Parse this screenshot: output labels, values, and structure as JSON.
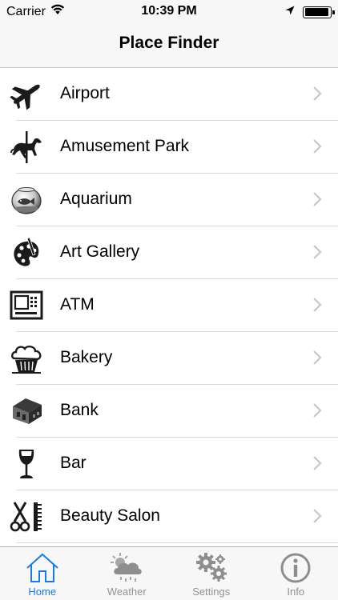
{
  "status_bar": {
    "carrier": "Carrier",
    "time": "10:39 PM",
    "battery_level": 0.95
  },
  "nav": {
    "title": "Place Finder"
  },
  "places": [
    {
      "label": "Airport",
      "icon": "airplane-icon"
    },
    {
      "label": "Amusement Park",
      "icon": "carousel-horse-icon"
    },
    {
      "label": "Aquarium",
      "icon": "fishbowl-icon"
    },
    {
      "label": "Art Gallery",
      "icon": "palette-icon"
    },
    {
      "label": "ATM",
      "icon": "atm-icon"
    },
    {
      "label": "Bakery",
      "icon": "muffin-icon"
    },
    {
      "label": "Bank",
      "icon": "bank-building-icon"
    },
    {
      "label": "Bar",
      "icon": "wine-glass-icon"
    },
    {
      "label": "Beauty Salon",
      "icon": "scissors-comb-icon"
    }
  ],
  "tabs": [
    {
      "label": "Home",
      "icon": "home-icon",
      "active": true
    },
    {
      "label": "Weather",
      "icon": "weather-cloud-icon",
      "active": false
    },
    {
      "label": "Settings",
      "icon": "gears-icon",
      "active": false
    },
    {
      "label": "Info",
      "icon": "info-icon",
      "active": false
    }
  ],
  "colors": {
    "accent": "#1a7ae6",
    "inactive_tab": "#929292",
    "bar_background": "#f7f7f7",
    "chevron": "#c7c7cc"
  }
}
